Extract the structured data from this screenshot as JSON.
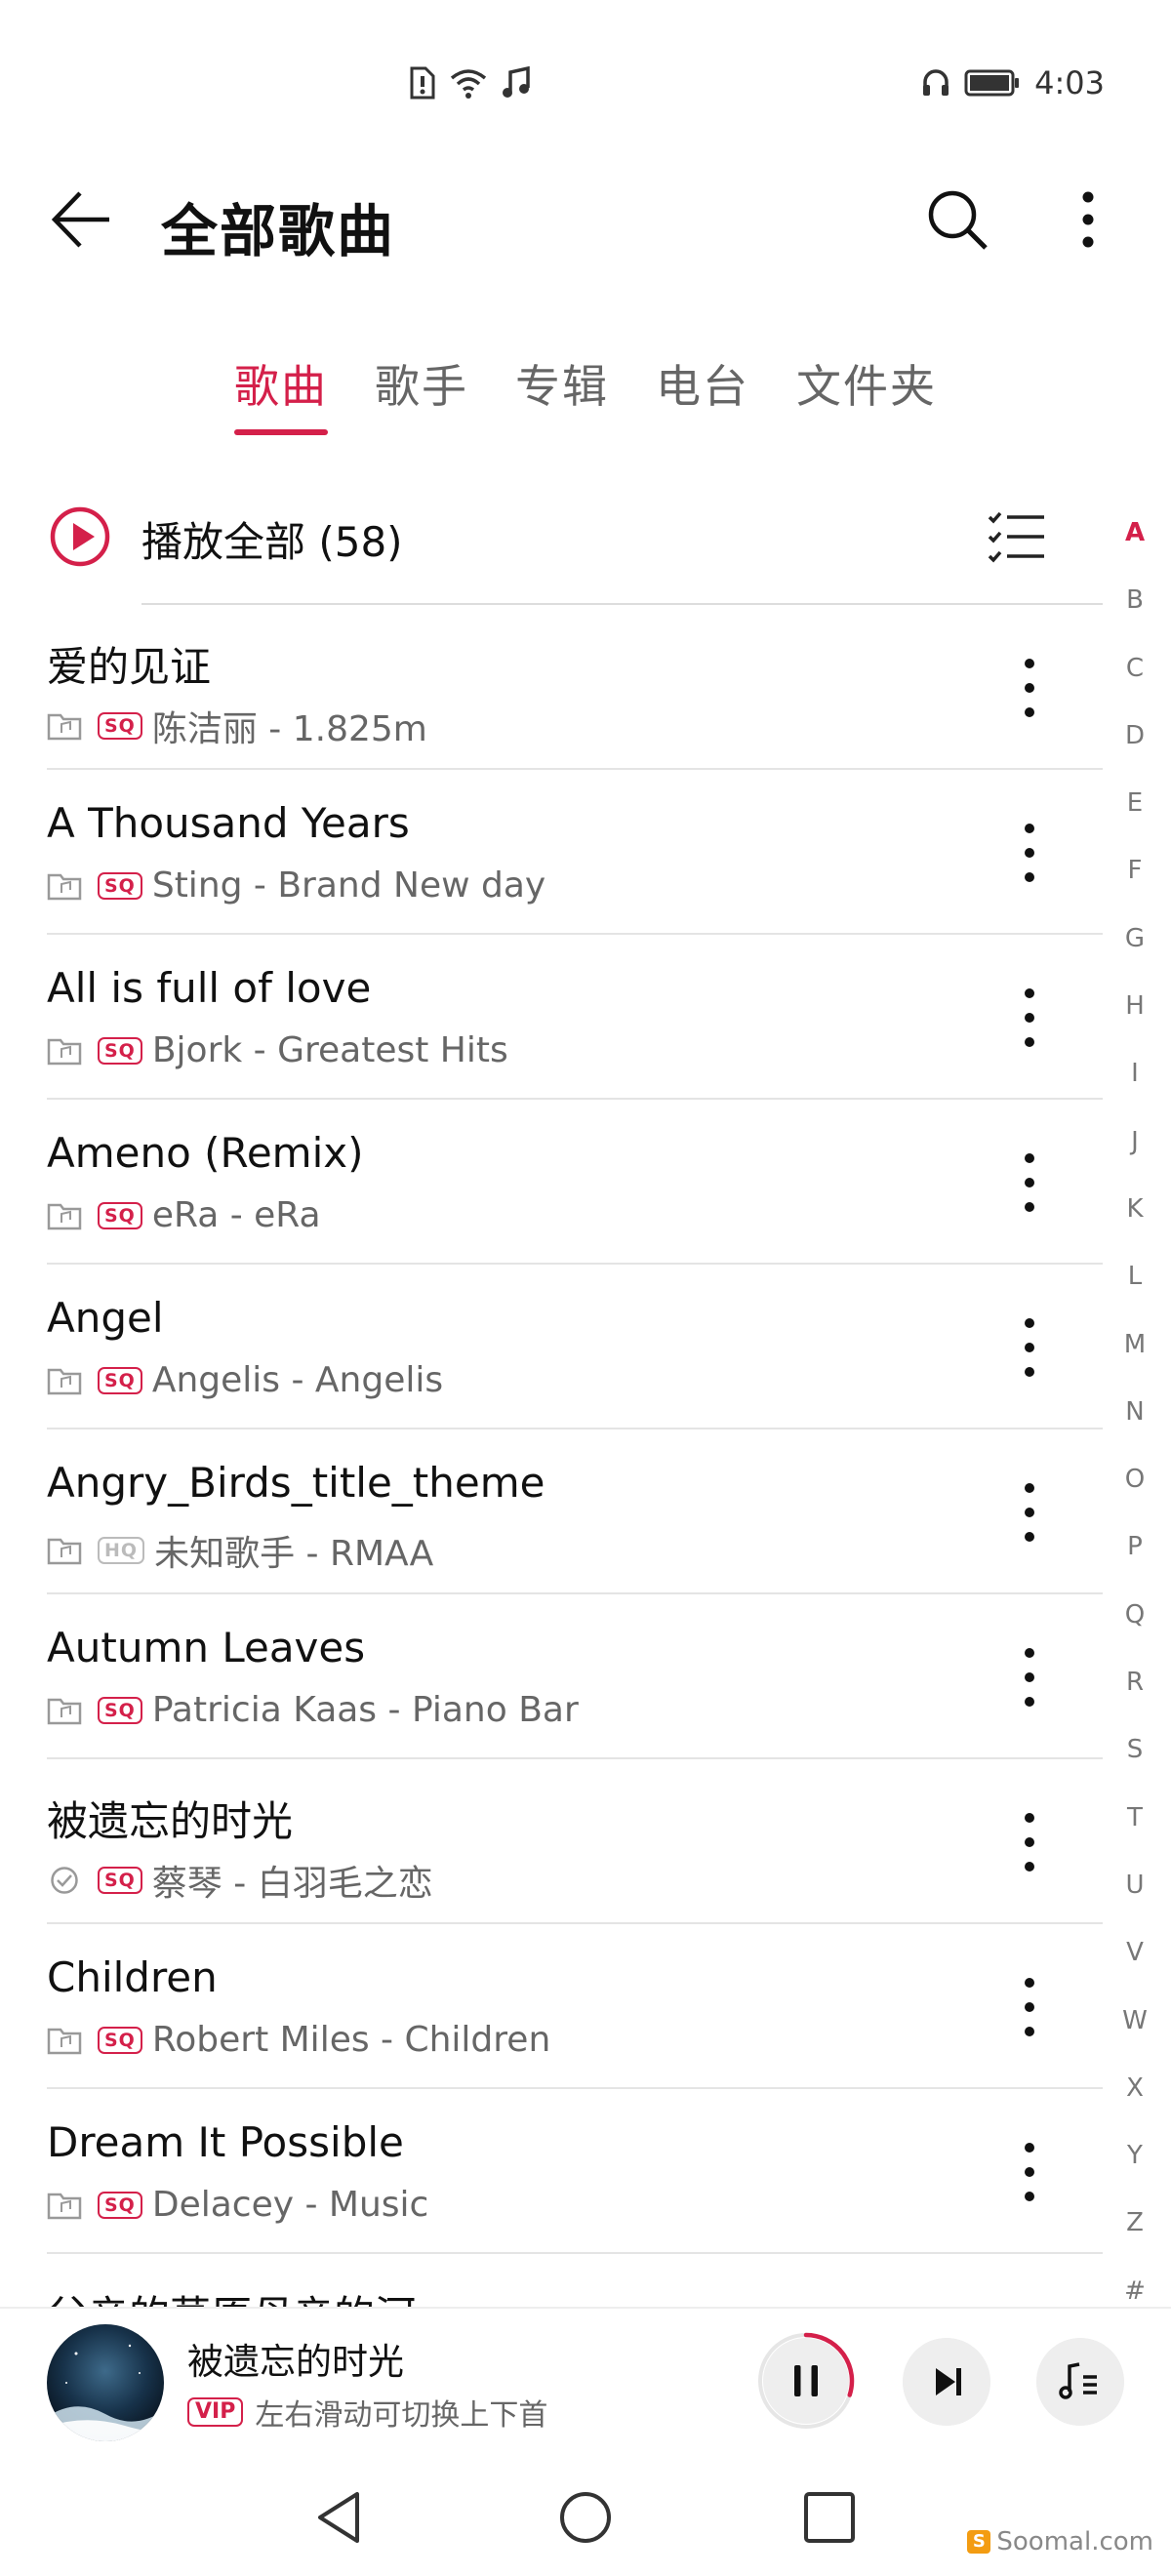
{
  "status_bar": {
    "time": "4:03",
    "left_icons": [
      "sim-alert-icon",
      "wifi-icon",
      "music-note-icon"
    ],
    "right_icons": [
      "headphones-icon",
      "battery-icon"
    ]
  },
  "header": {
    "title": "全部歌曲",
    "icons": [
      "back-arrow-icon",
      "search-icon",
      "more-vertical-icon"
    ]
  },
  "tabs": [
    {
      "label": "歌曲",
      "active": true
    },
    {
      "label": "歌手",
      "active": false
    },
    {
      "label": "专辑",
      "active": false
    },
    {
      "label": "电台",
      "active": false
    },
    {
      "label": "文件夹",
      "active": false
    }
  ],
  "play_all": {
    "label": "播放全部 (58)"
  },
  "songs": [
    {
      "title": "爱的见证",
      "quality": "SQ",
      "subtitle": "陈洁丽 - 1.825m",
      "status_icon": "local-file-icon"
    },
    {
      "title": "A Thousand Years",
      "quality": "SQ",
      "subtitle": "Sting - Brand New day",
      "status_icon": "local-file-icon"
    },
    {
      "title": "All is full of love",
      "quality": "SQ",
      "subtitle": "Bjork - Greatest Hits",
      "status_icon": "local-file-icon"
    },
    {
      "title": "Ameno (Remix)",
      "quality": "SQ",
      "subtitle": "eRa - eRa",
      "status_icon": "local-file-icon"
    },
    {
      "title": "Angel",
      "quality": "SQ",
      "subtitle": "Angelis - Angelis",
      "status_icon": "local-file-icon"
    },
    {
      "title": "Angry_Birds_title_theme",
      "quality": "HQ",
      "subtitle": "未知歌手 - RMAA",
      "status_icon": "local-file-icon"
    },
    {
      "title": "Autumn Leaves",
      "quality": "SQ",
      "subtitle": "Patricia Kaas - Piano Bar",
      "status_icon": "local-file-icon"
    },
    {
      "title": "被遗忘的时光",
      "quality": "SQ",
      "subtitle": "蔡琴 - 白羽毛之恋",
      "status_icon": "check-circle-icon"
    },
    {
      "title": "Children",
      "quality": "SQ",
      "subtitle": "Robert Miles - Children",
      "status_icon": "local-file-icon"
    },
    {
      "title": "Dream It Possible",
      "quality": "SQ",
      "subtitle": "Delacey - Music",
      "status_icon": "local-file-icon"
    }
  ],
  "partial_song": {
    "title": "父亲的草原母亲的河"
  },
  "az_index": [
    "A",
    "B",
    "C",
    "D",
    "E",
    "F",
    "G",
    "H",
    "I",
    "J",
    "K",
    "L",
    "M",
    "N",
    "O",
    "P",
    "Q",
    "R",
    "S",
    "T",
    "U",
    "V",
    "W",
    "X",
    "Y",
    "Z",
    "#"
  ],
  "az_active": "A",
  "player": {
    "title": "被遗忘的时光",
    "vip_badge": "VIP",
    "hint": "左右滑动可切换上下首",
    "progress": 0.3
  },
  "nav_bar": {
    "icons": [
      "nav-back-icon",
      "nav-home-icon",
      "nav-recent-icon"
    ]
  },
  "watermark": "Soomal.com",
  "colors": {
    "accent": "#d4204a",
    "text_primary": "#111111",
    "text_secondary": "#666666",
    "divider": "#e4e4e4"
  }
}
